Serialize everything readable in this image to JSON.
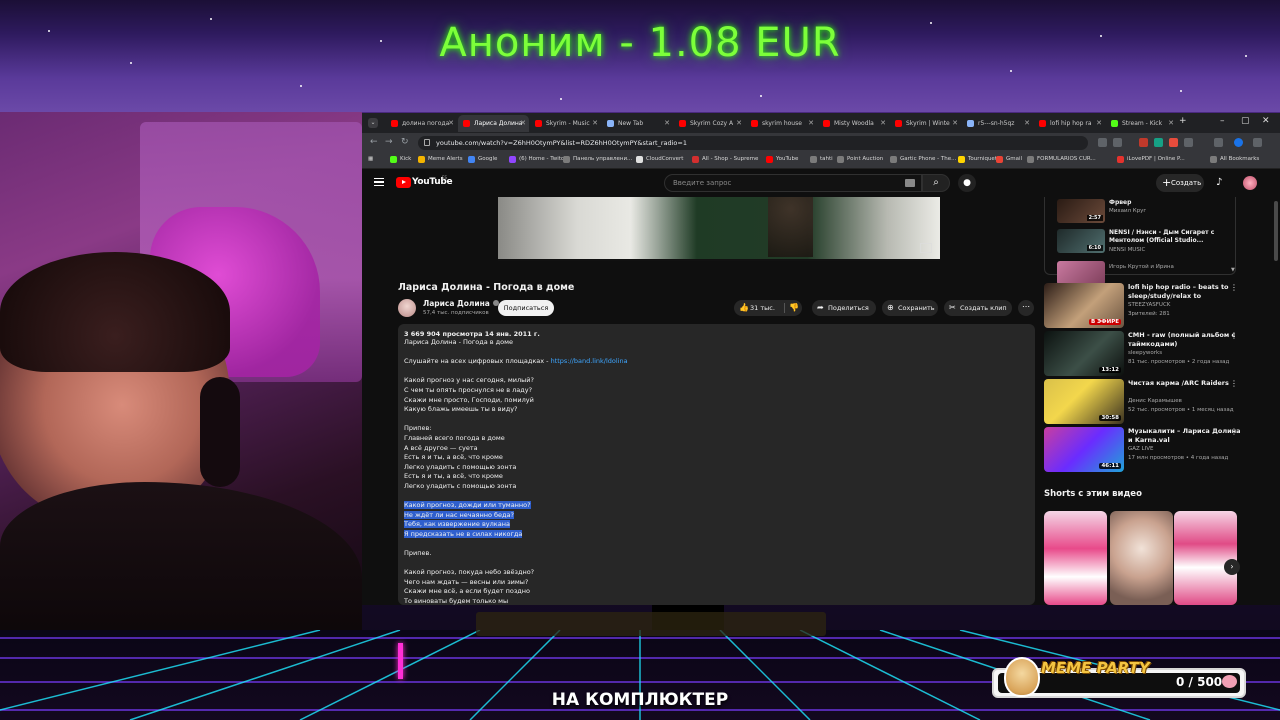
{
  "overlay": {
    "donation_text": "Аноним - 1.08 EUR",
    "caption": "НА КОМПЛЮКТЕР",
    "meme_party": {
      "title": "MEME PARTY",
      "count": "0 / 500"
    }
  },
  "browser": {
    "tabs": [
      {
        "label": "долина погода",
        "color": "#ff0000"
      },
      {
        "label": "Лариса Долина",
        "color": "#ff0000",
        "active": true
      },
      {
        "label": "Skyrim - Music",
        "color": "#ff0000"
      },
      {
        "label": "New Tab",
        "color": "#8ab4f8"
      },
      {
        "label": "Skyrim Cozy A",
        "color": "#ff0000"
      },
      {
        "label": "skyrim house",
        "color": "#ff0000"
      },
      {
        "label": "Misty Woodla",
        "color": "#ff0000"
      },
      {
        "label": "Skyrim | Winte",
        "color": "#ff0000"
      },
      {
        "label": "r5---sn-h5qz",
        "color": "#8ab4f8"
      },
      {
        "label": "lofi hip hop ra",
        "color": "#ff0000"
      },
      {
        "label": "Stream - Kick",
        "color": "#53fc18"
      }
    ],
    "url": "youtube.com/watch?v=Z6hH0OtymPY&list=RDZ6hH0OtymPY&start_radio=1",
    "bookmarks": [
      {
        "label": "Kick",
        "color": "#53fc18"
      },
      {
        "label": "Meme Alerts",
        "color": "#f4b400"
      },
      {
        "label": "Google",
        "color": "#4285f4"
      },
      {
        "label": "(6) Home - Twitch",
        "color": "#9146ff"
      },
      {
        "label": "Панель управлени...",
        "color": "#7b7b7b"
      },
      {
        "label": "CloudConvert",
        "color": "#e0e0e0"
      },
      {
        "label": "All - Shop - Supreme",
        "color": "#d32f2f"
      },
      {
        "label": "YouTube",
        "color": "#ff0000"
      },
      {
        "label": "tahti",
        "color": "#7b7b7b"
      },
      {
        "label": "Point Auction",
        "color": "#7b7b7b"
      },
      {
        "label": "Gartic Phone - The...",
        "color": "#7b7b7b"
      },
      {
        "label": "Tourniquet",
        "color": "#ffd400"
      },
      {
        "label": "Gmail",
        "color": "#ea4335"
      },
      {
        "label": "FORMULARIOS CUR...",
        "color": "#7b7b7b"
      },
      {
        "label": "iLovePDF | Online P...",
        "color": "#e5322d"
      },
      {
        "label": "All Bookmarks",
        "color": "#7b7b7b"
      }
    ]
  },
  "youtube": {
    "logo_text": "YouTube",
    "logo_region": "ES",
    "search_placeholder": "Введите запрос",
    "create_label": "Создать",
    "video": {
      "title": "Лариса Долина - Погода в доме",
      "channel": "Лариса Долина",
      "subs": "57,4 тыс. подписчиков",
      "subscribe": "Подписаться",
      "likes": "31 тыс.",
      "share": "Поделиться",
      "save": "Сохранить",
      "clip": "Создать клип"
    },
    "description": {
      "meta": "3 669 904 просмотра  14 янв. 2011 г.",
      "subtitle": "Лариса Долина - Погода в доме",
      "listen_prefix": "Слушайте на всех цифровых площадках - ",
      "listen_link": "https://band.link/ldolina",
      "verse1": [
        "Какой прогноз у нас сегодня, милый?",
        "С чем ты опять проснулся не в ладу?",
        "Скажи мне просто, Господи, помилуй",
        "Какую блажь имеешь ты в виду?"
      ],
      "chorus": [
        "Припев:",
        "Главней всего погода в доме",
        "А всё другое — суета",
        "Есть я и ты, а всё, что кроме",
        "Легко уладить с помощью зонта",
        "Есть я и ты, а всё, что кроме",
        "Легко уладить с помощью зонта"
      ],
      "verse2": [
        "Какой прогноз, дожди или туманно?",
        "Не ждёт ли нас нечаянно беда?",
        "Тебя, как извержение вулкана",
        "Я предсказать не в силах никогда"
      ],
      "chorus2": "Припев.",
      "verse3": [
        "Какой прогноз, покуда небо звёздно?",
        "Чего нам ждать — весны или зимы?",
        "Скажи мне всё, а если будет поздно",
        "То виноваты будем только мы"
      ]
    },
    "playlist": [
      {
        "title": "Фрвер",
        "channel": "Михаил Круг",
        "duration": "2:57"
      },
      {
        "title": "NENSI / Нэнси - Дым Сигарет с Ментолом (Official Studio...",
        "channel": "NENSI MUSIC",
        "duration": "6:10"
      },
      {
        "title": "",
        "channel": "Игорь Крутой и Ирина",
        "duration": ""
      }
    ],
    "recommendations": [
      {
        "title": "lofi hip hop radio – beats to sleep/study/relax to",
        "channel": "STEEZYASFUCK",
        "meta": "Зрителей: 281",
        "badge": "В ЭФИРЕ",
        "live": true
      },
      {
        "title": "CMH - raw (полный альбом с таймкодами)",
        "channel": "sleepyworks",
        "meta": "81 тыс. просмотров • 2 года назад",
        "badge": "13:12",
        "live": false
      },
      {
        "title": "Чистая карма /ARC Raiders",
        "channel": "Денис Карамышев",
        "meta": "52 тыс. просмотров • 1 месяц назад",
        "badge": "30:58",
        "live": false
      },
      {
        "title": "Музыкалити – Лариса Долина и Karna.val",
        "channel": "GAZ LIVE",
        "meta": "17 млн просмотров • 4 года назад",
        "badge": "46:11",
        "live": false
      }
    ],
    "shorts_heading": "Shorts с этим видео"
  }
}
